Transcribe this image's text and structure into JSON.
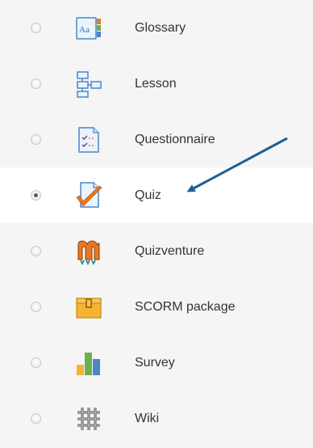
{
  "activities": [
    {
      "label": "Glossary",
      "icon": "glossary-icon",
      "selected": false
    },
    {
      "label": "Lesson",
      "icon": "lesson-icon",
      "selected": false
    },
    {
      "label": "Questionnaire",
      "icon": "questionnaire-icon",
      "selected": false
    },
    {
      "label": "Quiz",
      "icon": "quiz-icon",
      "selected": true
    },
    {
      "label": "Quizventure",
      "icon": "quizventure-icon",
      "selected": false
    },
    {
      "label": "SCORM package",
      "icon": "scorm-package-icon",
      "selected": false
    },
    {
      "label": "Survey",
      "icon": "survey-icon",
      "selected": false
    },
    {
      "label": "Wiki",
      "icon": "wiki-icon",
      "selected": false
    }
  ],
  "colors": {
    "arrow": "#1f5f97",
    "row_background": "#f5f5f5",
    "selected_background": "#ffffff",
    "label_text": "#333333"
  }
}
